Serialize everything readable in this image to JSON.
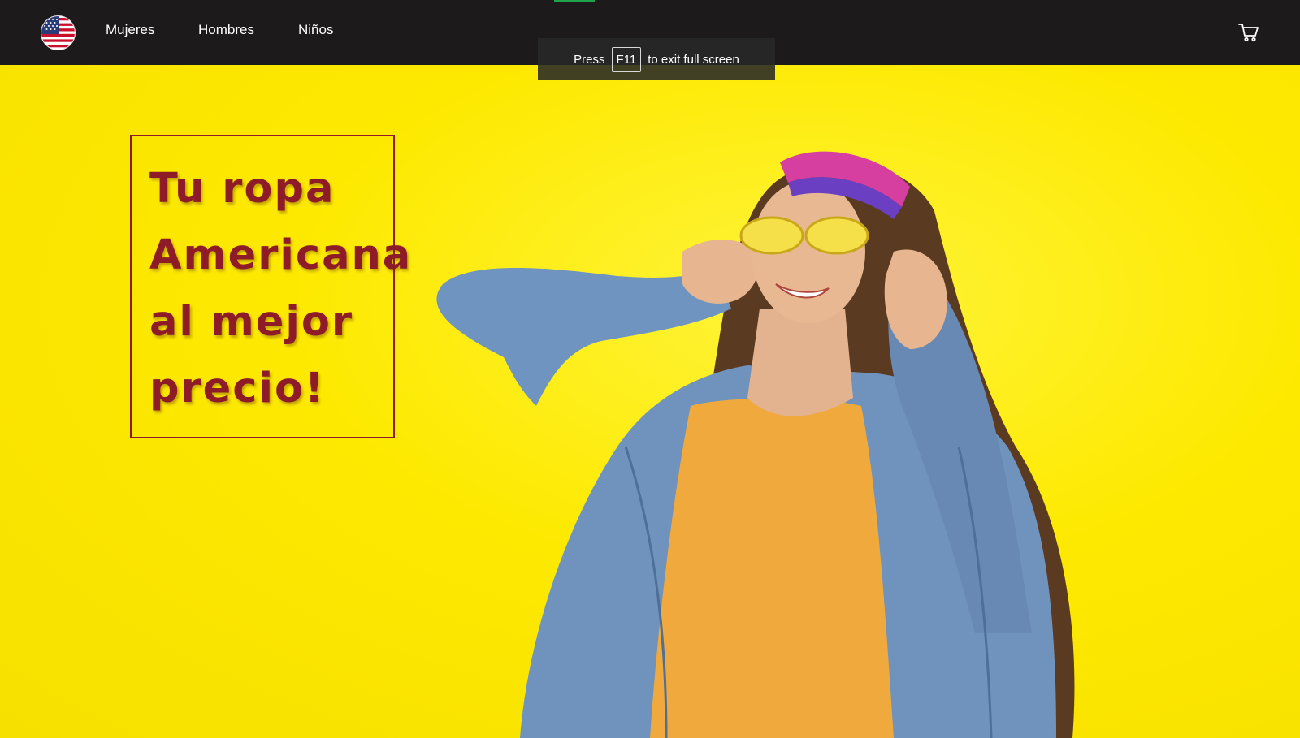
{
  "nav": {
    "links": [
      "Mujeres",
      "Hombres",
      "Niños"
    ],
    "logo_icon": "us-flag-icon",
    "cart_icon": "shopping-cart-icon"
  },
  "fullscreen_toast": {
    "press": "Press",
    "key": "F11",
    "suffix": "to exit full screen"
  },
  "hero": {
    "headline_lines": [
      "Tu ropa",
      "Americana",
      "al mejor",
      "precio!"
    ],
    "background_color": "#fde900",
    "headline_color": "#8e1b28"
  },
  "colors": {
    "navbar": "#1c1a1a",
    "accent_tick": "#1fa34a"
  }
}
